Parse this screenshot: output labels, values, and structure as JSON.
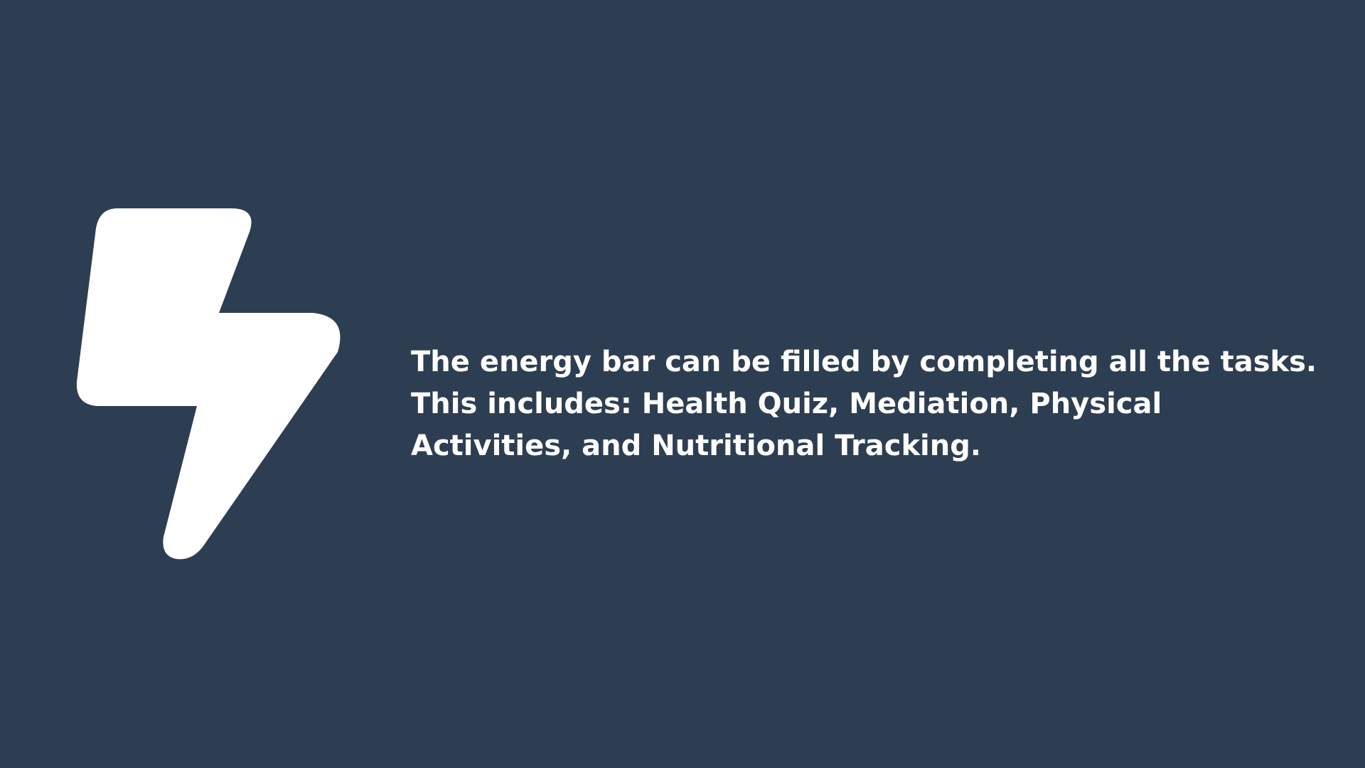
{
  "screen": {
    "background_color": "#2e3e52",
    "icon": "lightning-bolt-icon",
    "icon_color": "#ffffff",
    "message": "The energy bar can be filled by completing all the tasks. This includes: Health Quiz, Mediation, Physical Activities, and Nutritional Tracking.",
    "text_color": "#ffffff"
  }
}
